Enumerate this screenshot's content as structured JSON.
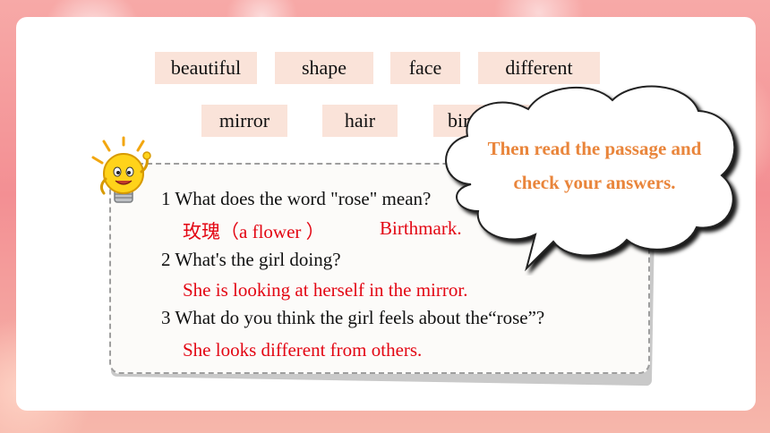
{
  "words_row1": [
    "beautiful",
    "shape",
    "face",
    "different"
  ],
  "words_row2": [
    "mirror",
    "hair",
    "birthmark"
  ],
  "questions": [
    {
      "q": "1 What does the word \"rose\" mean?",
      "a1": "玫瑰（a flower ）",
      "a2": "Birthmark."
    },
    {
      "q": "2 What's the girl doing?",
      "a": "She is looking at herself in the mirror."
    },
    {
      "q": "3 What do you think the girl feels about the“rose”?",
      "a": "She looks different from others."
    }
  ],
  "bubble": {
    "line1": "Then read the passage and",
    "line2": "check your answers."
  },
  "colors": {
    "answer": "#e30613",
    "bubble_text": "#e9853b",
    "word_bg": "#fae3d9"
  }
}
